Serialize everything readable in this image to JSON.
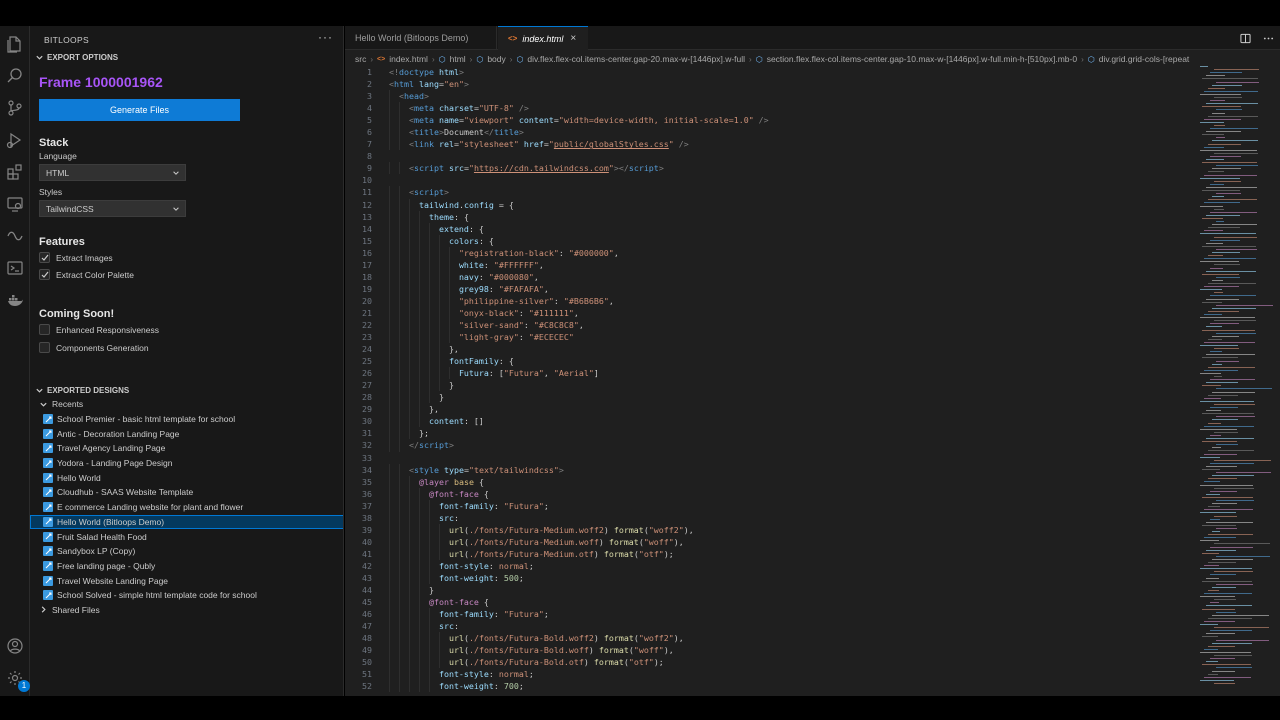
{
  "sidebar": {
    "title": "BITLOOPS",
    "more": "···",
    "export_options_label": "EXPORT OPTIONS",
    "frame_title": "Frame 1000001962",
    "generate_button": "Generate Files",
    "stack_heading": "Stack",
    "language_label": "Language",
    "language_value": "HTML",
    "styles_label": "Styles",
    "styles_value": "TailwindCSS",
    "features_heading": "Features",
    "features": [
      {
        "label": "Extract Images",
        "checked": true
      },
      {
        "label": "Extract Color Palette",
        "checked": true
      }
    ],
    "coming_heading": "Coming Soon!",
    "coming": [
      {
        "label": "Enhanced Responsiveness",
        "checked": false
      },
      {
        "label": "Components Generation",
        "checked": false
      }
    ],
    "exported_designs_label": "EXPORTED DESIGNS",
    "recents_label": "Recents",
    "recents": [
      "School Premier - basic html template for school",
      "Antic - Decoration Landing Page",
      "Travel Agency Landing Page",
      "Yodora - Landing Page Design",
      "Hello World",
      "Cloudhub - SAAS Website Template",
      "E commerce Landing website for plant and flower",
      "Hello World (Bitloops Demo)",
      "Fruit Salad Health Food",
      "Sandybox LP (Copy)",
      "Free landing page - Qubly",
      "Travel Website Landing Page",
      "School Solved - simple html template code for school"
    ],
    "selected_recent": 7,
    "shared_files_label": "Shared Files"
  },
  "activity": {
    "icons": [
      "files-icon",
      "search-icon",
      "source-control-icon",
      "run-debug-icon",
      "extensions-icon",
      "remote-explorer-icon",
      "bitloops-icon",
      "terminal-icon",
      "docker-icon"
    ],
    "bottom_icons": [
      "account-icon",
      "settings-gear-icon"
    ],
    "settings_badge": "1"
  },
  "editor": {
    "tabs": [
      {
        "label": "Hello World (Bitloops Demo)",
        "active": false
      },
      {
        "label": "index.html",
        "active": true,
        "icon": "<>"
      }
    ],
    "close_glyph": "×",
    "breadcrumb": [
      "src",
      "index.html",
      "html",
      "body",
      "div.flex.flex-col.items-center.gap-20.max-w-[1446px].w-full",
      "section.flex.flex-col.items-center.gap-10.max-w-[1446px].w-full.min-h-[510px].mb-0",
      "div.grid.grid-cols-[repeat"
    ],
    "code": [
      [
        [
          "#808080",
          "<!"
        ],
        [
          "#569cd6",
          "doctype"
        ],
        [
          "#9cdcfe",
          " html"
        ],
        [
          "#808080",
          ">"
        ]
      ],
      [
        [
          "#808080",
          "<"
        ],
        [
          "#569cd6",
          "html"
        ],
        [
          "#9cdcfe",
          " lang"
        ],
        [
          "#cccccc",
          "="
        ],
        [
          "#ce9178",
          "\"en\""
        ],
        [
          "#808080",
          ">"
        ]
      ],
      [
        [
          "#cccccc",
          "  "
        ],
        [
          "#808080",
          "<"
        ],
        [
          "#569cd6",
          "head"
        ],
        [
          "#808080",
          ">"
        ]
      ],
      [
        [
          "#cccccc",
          "    "
        ],
        [
          "#808080",
          "<"
        ],
        [
          "#569cd6",
          "meta"
        ],
        [
          "#9cdcfe",
          " charset"
        ],
        [
          "#cccccc",
          "="
        ],
        [
          "#ce9178",
          "\"UTF-8\""
        ],
        [
          "#808080",
          " />"
        ]
      ],
      [
        [
          "#cccccc",
          "    "
        ],
        [
          "#808080",
          "<"
        ],
        [
          "#569cd6",
          "meta"
        ],
        [
          "#9cdcfe",
          " name"
        ],
        [
          "#cccccc",
          "="
        ],
        [
          "#ce9178",
          "\"viewport\""
        ],
        [
          "#9cdcfe",
          " content"
        ],
        [
          "#cccccc",
          "="
        ],
        [
          "#ce9178",
          "\"width=device-width, initial-scale=1.0\""
        ],
        [
          "#808080",
          " />"
        ]
      ],
      [
        [
          "#cccccc",
          "    "
        ],
        [
          "#808080",
          "<"
        ],
        [
          "#569cd6",
          "title"
        ],
        [
          "#808080",
          ">"
        ],
        [
          "#cccccc",
          "Document"
        ],
        [
          "#808080",
          "</"
        ],
        [
          "#569cd6",
          "title"
        ],
        [
          "#808080",
          ">"
        ]
      ],
      [
        [
          "#cccccc",
          "    "
        ],
        [
          "#808080",
          "<"
        ],
        [
          "#569cd6",
          "link"
        ],
        [
          "#9cdcfe",
          " rel"
        ],
        [
          "#cccccc",
          "="
        ],
        [
          "#ce9178",
          "\"stylesheet\""
        ],
        [
          "#9cdcfe",
          " href"
        ],
        [
          "#cccccc",
          "="
        ],
        [
          "#ce9178",
          "\""
        ],
        [
          "#ce9178u",
          "public/globalStyles.css"
        ],
        [
          "#ce9178",
          "\""
        ],
        [
          "#808080",
          " />"
        ]
      ],
      [],
      [
        [
          "#cccccc",
          "    "
        ],
        [
          "#808080",
          "<"
        ],
        [
          "#569cd6",
          "script"
        ],
        [
          "#9cdcfe",
          " src"
        ],
        [
          "#cccccc",
          "="
        ],
        [
          "#ce9178",
          "\""
        ],
        [
          "#ce9178u",
          "https://cdn.tailwindcss.com"
        ],
        [
          "#ce9178",
          "\""
        ],
        [
          "#808080",
          "></"
        ],
        [
          "#569cd6",
          "script"
        ],
        [
          "#808080",
          ">"
        ]
      ],
      [],
      [
        [
          "#cccccc",
          "    "
        ],
        [
          "#808080",
          "<"
        ],
        [
          "#569cd6",
          "script"
        ],
        [
          "#808080",
          ">"
        ]
      ],
      [
        [
          "#cccccc",
          "      "
        ],
        [
          "#9cdcfe",
          "tailwind"
        ],
        [
          "#cccccc",
          "."
        ],
        [
          "#9cdcfe",
          "config"
        ],
        [
          "#cccccc",
          " = {"
        ]
      ],
      [
        [
          "#cccccc",
          "        "
        ],
        [
          "#9cdcfe",
          "theme"
        ],
        [
          "#cccccc",
          ": {"
        ]
      ],
      [
        [
          "#cccccc",
          "          "
        ],
        [
          "#9cdcfe",
          "extend"
        ],
        [
          "#cccccc",
          ": {"
        ]
      ],
      [
        [
          "#cccccc",
          "            "
        ],
        [
          "#9cdcfe",
          "colors"
        ],
        [
          "#cccccc",
          ": {"
        ]
      ],
      [
        [
          "#cccccc",
          "              "
        ],
        [
          "#ce9178",
          "\"registration-black\""
        ],
        [
          "#cccccc",
          ": "
        ],
        [
          "#ce9178",
          "\"#000000\""
        ],
        [
          "#cccccc",
          ","
        ]
      ],
      [
        [
          "#cccccc",
          "              "
        ],
        [
          "#9cdcfe",
          "white"
        ],
        [
          "#cccccc",
          ": "
        ],
        [
          "#ce9178",
          "\"#FFFFFF\""
        ],
        [
          "#cccccc",
          ","
        ]
      ],
      [
        [
          "#cccccc",
          "              "
        ],
        [
          "#9cdcfe",
          "navy"
        ],
        [
          "#cccccc",
          ": "
        ],
        [
          "#ce9178",
          "\"#000080\""
        ],
        [
          "#cccccc",
          ","
        ]
      ],
      [
        [
          "#cccccc",
          "              "
        ],
        [
          "#9cdcfe",
          "grey98"
        ],
        [
          "#cccccc",
          ": "
        ],
        [
          "#ce9178",
          "\"#FAFAFA\""
        ],
        [
          "#cccccc",
          ","
        ]
      ],
      [
        [
          "#cccccc",
          "              "
        ],
        [
          "#ce9178",
          "\"philippine-silver\""
        ],
        [
          "#cccccc",
          ": "
        ],
        [
          "#ce9178",
          "\"#B6B6B6\""
        ],
        [
          "#cccccc",
          ","
        ]
      ],
      [
        [
          "#cccccc",
          "              "
        ],
        [
          "#ce9178",
          "\"onyx-black\""
        ],
        [
          "#cccccc",
          ": "
        ],
        [
          "#ce9178",
          "\"#111111\""
        ],
        [
          "#cccccc",
          ","
        ]
      ],
      [
        [
          "#cccccc",
          "              "
        ],
        [
          "#ce9178",
          "\"silver-sand\""
        ],
        [
          "#cccccc",
          ": "
        ],
        [
          "#ce9178",
          "\"#C8C8C8\""
        ],
        [
          "#cccccc",
          ","
        ]
      ],
      [
        [
          "#cccccc",
          "              "
        ],
        [
          "#ce9178",
          "\"light-gray\""
        ],
        [
          "#cccccc",
          ": "
        ],
        [
          "#ce9178",
          "\"#ECECEC\""
        ]
      ],
      [
        [
          "#cccccc",
          "            },"
        ]
      ],
      [
        [
          "#cccccc",
          "            "
        ],
        [
          "#9cdcfe",
          "fontFamily"
        ],
        [
          "#cccccc",
          ": {"
        ]
      ],
      [
        [
          "#cccccc",
          "              "
        ],
        [
          "#9cdcfe",
          "Futura"
        ],
        [
          "#cccccc",
          ": ["
        ],
        [
          "#ce9178",
          "\"Futura\""
        ],
        [
          "#cccccc",
          ", "
        ],
        [
          "#ce9178",
          "\"Aerial\""
        ],
        [
          "#cccccc",
          "]"
        ]
      ],
      [
        [
          "#cccccc",
          "            }"
        ]
      ],
      [
        [
          "#cccccc",
          "          }"
        ]
      ],
      [
        [
          "#cccccc",
          "        },"
        ]
      ],
      [
        [
          "#cccccc",
          "        "
        ],
        [
          "#9cdcfe",
          "content"
        ],
        [
          "#cccccc",
          ": []"
        ]
      ],
      [
        [
          "#cccccc",
          "      };"
        ]
      ],
      [
        [
          "#cccccc",
          "    "
        ],
        [
          "#808080",
          "</"
        ],
        [
          "#569cd6",
          "script"
        ],
        [
          "#808080",
          ">"
        ]
      ],
      [],
      [
        [
          "#cccccc",
          "    "
        ],
        [
          "#808080",
          "<"
        ],
        [
          "#569cd6",
          "style"
        ],
        [
          "#9cdcfe",
          " type"
        ],
        [
          "#cccccc",
          "="
        ],
        [
          "#ce9178",
          "\"text/tailwindcss\""
        ],
        [
          "#808080",
          ">"
        ]
      ],
      [
        [
          "#cccccc",
          "      "
        ],
        [
          "#c586c0",
          "@layer"
        ],
        [
          "#d7ba7d",
          " base"
        ],
        [
          "#cccccc",
          " {"
        ]
      ],
      [
        [
          "#cccccc",
          "        "
        ],
        [
          "#c586c0",
          "@font-face"
        ],
        [
          "#cccccc",
          " {"
        ]
      ],
      [
        [
          "#cccccc",
          "          "
        ],
        [
          "#9cdcfe",
          "font-family"
        ],
        [
          "#cccccc",
          ": "
        ],
        [
          "#ce9178",
          "\"Futura\""
        ],
        [
          "#cccccc",
          ";"
        ]
      ],
      [
        [
          "#cccccc",
          "          "
        ],
        [
          "#9cdcfe",
          "src"
        ],
        [
          "#cccccc",
          ":"
        ]
      ],
      [
        [
          "#cccccc",
          "            "
        ],
        [
          "#dcdcaa",
          "url"
        ],
        [
          "#cccccc",
          "("
        ],
        [
          "#ce9178",
          "./fonts/Futura-Medium.woff2"
        ],
        [
          "#cccccc",
          ") "
        ],
        [
          "#dcdcaa",
          "format"
        ],
        [
          "#cccccc",
          "("
        ],
        [
          "#ce9178",
          "\"woff2\""
        ],
        [
          "#cccccc",
          "),"
        ]
      ],
      [
        [
          "#cccccc",
          "            "
        ],
        [
          "#dcdcaa",
          "url"
        ],
        [
          "#cccccc",
          "("
        ],
        [
          "#ce9178",
          "./fonts/Futura-Medium.woff"
        ],
        [
          "#cccccc",
          ") "
        ],
        [
          "#dcdcaa",
          "format"
        ],
        [
          "#cccccc",
          "("
        ],
        [
          "#ce9178",
          "\"woff\""
        ],
        [
          "#cccccc",
          "),"
        ]
      ],
      [
        [
          "#cccccc",
          "            "
        ],
        [
          "#dcdcaa",
          "url"
        ],
        [
          "#cccccc",
          "("
        ],
        [
          "#ce9178",
          "./fonts/Futura-Medium.otf"
        ],
        [
          "#cccccc",
          ") "
        ],
        [
          "#dcdcaa",
          "format"
        ],
        [
          "#cccccc",
          "("
        ],
        [
          "#ce9178",
          "\"otf\""
        ],
        [
          "#cccccc",
          ");"
        ]
      ],
      [
        [
          "#cccccc",
          "          "
        ],
        [
          "#9cdcfe",
          "font-style"
        ],
        [
          "#cccccc",
          ": "
        ],
        [
          "#ce9178",
          "normal"
        ],
        [
          "#cccccc",
          ";"
        ]
      ],
      [
        [
          "#cccccc",
          "          "
        ],
        [
          "#9cdcfe",
          "font-weight"
        ],
        [
          "#cccccc",
          ": "
        ],
        [
          "#b5cea8",
          "500"
        ],
        [
          "#cccccc",
          ";"
        ]
      ],
      [
        [
          "#cccccc",
          "        }"
        ]
      ],
      [
        [
          "#cccccc",
          "        "
        ],
        [
          "#c586c0",
          "@font-face"
        ],
        [
          "#cccccc",
          " {"
        ]
      ],
      [
        [
          "#cccccc",
          "          "
        ],
        [
          "#9cdcfe",
          "font-family"
        ],
        [
          "#cccccc",
          ": "
        ],
        [
          "#ce9178",
          "\"Futura\""
        ],
        [
          "#cccccc",
          ";"
        ]
      ],
      [
        [
          "#cccccc",
          "          "
        ],
        [
          "#9cdcfe",
          "src"
        ],
        [
          "#cccccc",
          ":"
        ]
      ],
      [
        [
          "#cccccc",
          "            "
        ],
        [
          "#dcdcaa",
          "url"
        ],
        [
          "#cccccc",
          "("
        ],
        [
          "#ce9178",
          "./fonts/Futura-Bold.woff2"
        ],
        [
          "#cccccc",
          ") "
        ],
        [
          "#dcdcaa",
          "format"
        ],
        [
          "#cccccc",
          "("
        ],
        [
          "#ce9178",
          "\"woff2\""
        ],
        [
          "#cccccc",
          "),"
        ]
      ],
      [
        [
          "#cccccc",
          "            "
        ],
        [
          "#dcdcaa",
          "url"
        ],
        [
          "#cccccc",
          "("
        ],
        [
          "#ce9178",
          "./fonts/Futura-Bold.woff"
        ],
        [
          "#cccccc",
          ") "
        ],
        [
          "#dcdcaa",
          "format"
        ],
        [
          "#cccccc",
          "("
        ],
        [
          "#ce9178",
          "\"woff\""
        ],
        [
          "#cccccc",
          "),"
        ]
      ],
      [
        [
          "#cccccc",
          "            "
        ],
        [
          "#dcdcaa",
          "url"
        ],
        [
          "#cccccc",
          "("
        ],
        [
          "#ce9178",
          "./fonts/Futura-Bold.otf"
        ],
        [
          "#cccccc",
          ") "
        ],
        [
          "#dcdcaa",
          "format"
        ],
        [
          "#cccccc",
          "("
        ],
        [
          "#ce9178",
          "\"otf\""
        ],
        [
          "#cccccc",
          ");"
        ]
      ],
      [
        [
          "#cccccc",
          "          "
        ],
        [
          "#9cdcfe",
          "font-style"
        ],
        [
          "#cccccc",
          ": "
        ],
        [
          "#ce9178",
          "normal"
        ],
        [
          "#cccccc",
          ";"
        ]
      ],
      [
        [
          "#cccccc",
          "          "
        ],
        [
          "#9cdcfe",
          "font-weight"
        ],
        [
          "#cccccc",
          ": "
        ],
        [
          "#b5cea8",
          "700"
        ],
        [
          "#cccccc",
          ";"
        ]
      ]
    ]
  },
  "colors": {
    "accent": "#0078d4",
    "button": "#0e7bd6",
    "frame_title": "#a855f7",
    "editor_bg": "#1f1f1f",
    "sidebar_bg": "#181818"
  }
}
